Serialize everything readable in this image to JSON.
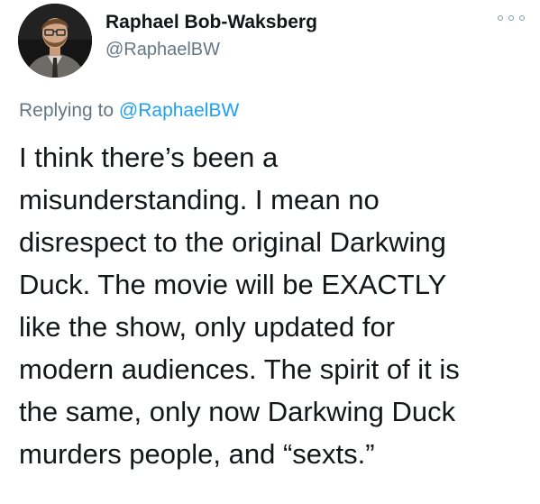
{
  "author": {
    "name": "Raphael Bob-Waksberg",
    "handle": "@RaphaelBW"
  },
  "reply": {
    "prefix": "Replying to ",
    "mention": "@RaphaelBW"
  },
  "tweet": {
    "lines": [
      "I think there’s been a",
      "misunderstanding. I mean no",
      "disrespect to the original Darkwing",
      "Duck. The movie will be EXACTLY",
      "like the show, only updated for",
      "modern audiences. The spirit of it is",
      "the same, only now Darkwing Duck",
      "murders people, and “sexts.”"
    ]
  },
  "icons": {
    "more": "more-options-icon",
    "avatar": "profile-photo"
  },
  "colors": {
    "text_primary": "#14171a",
    "text_secondary": "#657786",
    "link": "#1da1f2"
  }
}
